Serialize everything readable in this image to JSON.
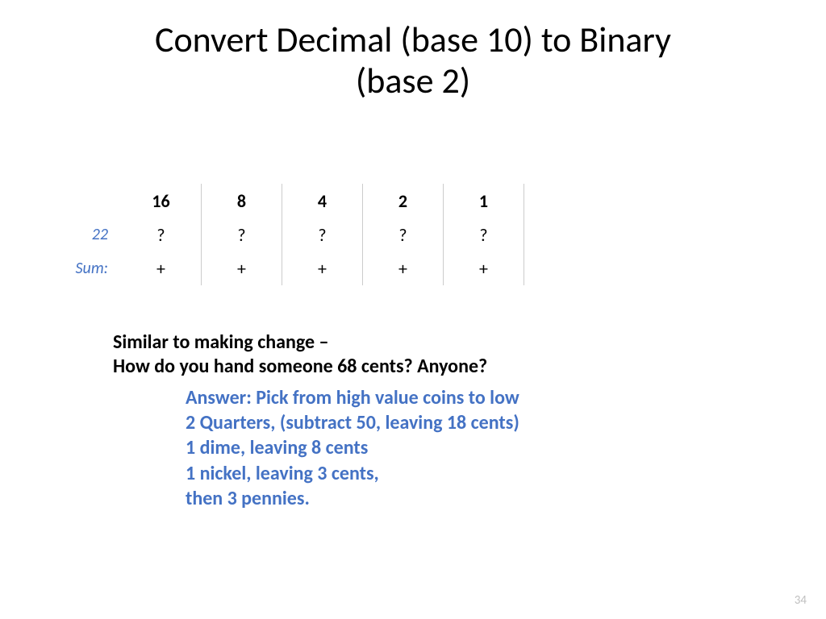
{
  "title_line1": "Convert Decimal (base 10) to Binary",
  "title_line2": "(base 2)",
  "table": {
    "headers": [
      "16",
      "8",
      "4",
      "2",
      "1"
    ],
    "row_label": "22",
    "row_cells": [
      "?",
      "?",
      "?",
      "?",
      "?"
    ],
    "sum_label": "Sum:",
    "sum_cells": [
      "+",
      "+",
      "+",
      "+",
      "+"
    ]
  },
  "question_line1": "Similar to making change –",
  "question_line2": "How do you hand someone 68 cents? Anyone?",
  "answer": {
    "l1": "Answer: Pick from high value coins to low",
    "l2": "2 Quarters, (subtract 50, leaving 18 cents)",
    "l3": "1 dime, leaving 8 cents",
    "l4": "1 nickel, leaving 3 cents,",
    "l5": "then 3 pennies."
  },
  "page_number": "34"
}
